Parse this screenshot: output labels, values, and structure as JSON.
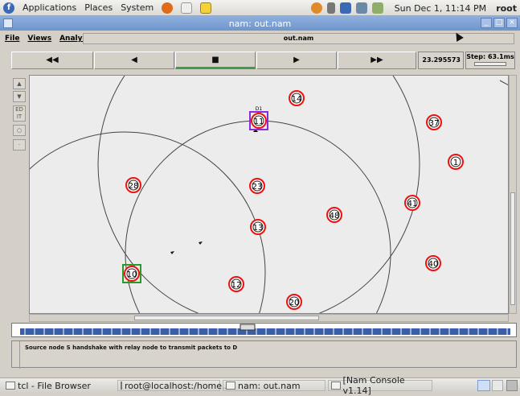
{
  "panel": {
    "menu": [
      "Applications",
      "Places",
      "System"
    ],
    "datetime": "Sun Dec  1, 11:14 PM",
    "user": "root"
  },
  "window": {
    "title": "nam: out.nam"
  },
  "menubar": {
    "items": [
      "File",
      "Views",
      "Analysis"
    ],
    "file_label": "out.nam"
  },
  "controls": {
    "rewind": "◀◀",
    "back": "◀",
    "stop": "■",
    "play": "▶",
    "fastforward": "▶▶",
    "time": "23.295573",
    "step": "Step: 63.1ms"
  },
  "canvas": {
    "nodes": [
      {
        "id": "14"
      },
      {
        "id": "11",
        "label": "D1"
      },
      {
        "id": "37"
      },
      {
        "id": "1"
      },
      {
        "id": "28"
      },
      {
        "id": "23"
      },
      {
        "id": "41"
      },
      {
        "id": "48"
      },
      {
        "id": "13"
      },
      {
        "id": "40"
      },
      {
        "id": "10"
      },
      {
        "id": "12"
      },
      {
        "id": "20"
      }
    ]
  },
  "annotation": {
    "text": "Source node S handshake with relay node to transmit packets to D"
  },
  "taskbar": {
    "items": [
      "tcl - File Browser",
      "root@localhost:/home...",
      "nam: out.nam",
      "[Nam Console v1.14]"
    ]
  }
}
